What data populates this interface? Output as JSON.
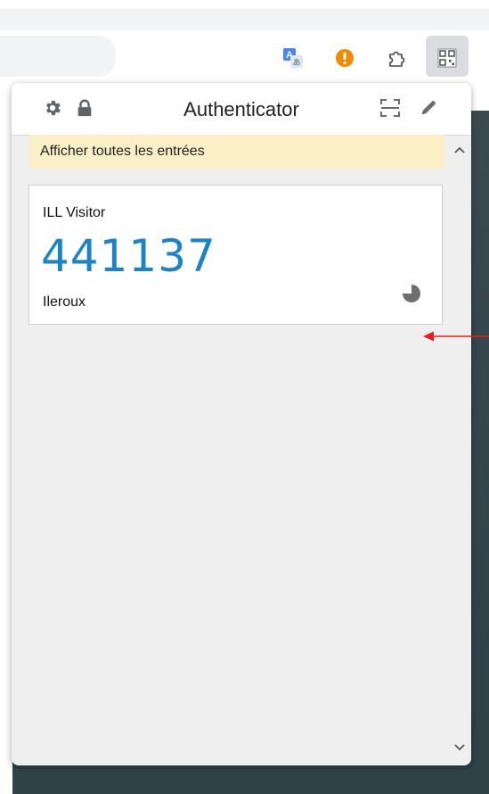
{
  "popup": {
    "title": "Authenticator",
    "notice": "Afficher toutes les entrées",
    "entries": [
      {
        "issuer": "ILL Visitor",
        "code": "441137",
        "account": "Ileroux"
      }
    ]
  },
  "colors": {
    "code": "#1a84c6",
    "notice_bg": "#fbefc7",
    "popup_bg": "#efefef",
    "annotation_arrow": "#e02020"
  },
  "icons": {
    "header_left": [
      "gear-icon",
      "lock-icon"
    ],
    "header_right": [
      "scan-qr-icon",
      "pencil-icon"
    ],
    "toolbar": [
      "translate-icon",
      "alert-icon",
      "extensions-puzzle-icon",
      "qr-code-extension-icon"
    ],
    "entry": [
      "timer-pie-icon"
    ],
    "scroll": [
      "chevron-up-icon",
      "chevron-down-icon"
    ]
  }
}
